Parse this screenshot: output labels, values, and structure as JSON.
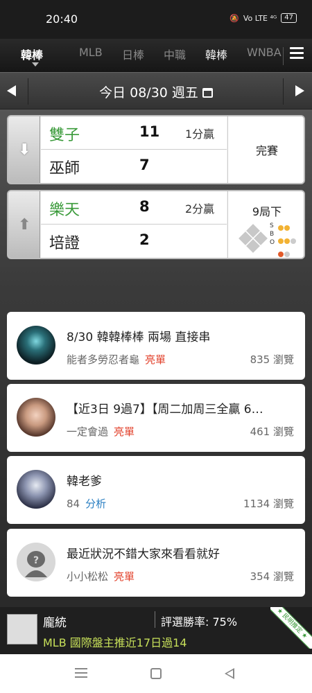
{
  "status_bar": {
    "time": "20:40",
    "network": "Vo LTE ⁴ᴳ",
    "battery": "47"
  },
  "tabs": {
    "active": "韓棒",
    "items": [
      "MLB",
      "日棒",
      "中職",
      "韓棒",
      "WNBA"
    ]
  },
  "datebar": {
    "date_text": "今日 08/30 週五"
  },
  "games": [
    {
      "home": {
        "name": "雙子",
        "score": "11",
        "note": "1分贏"
      },
      "away": {
        "name": "巫師",
        "score": "7",
        "note": ""
      },
      "status": "完賽"
    },
    {
      "home": {
        "name": "樂天",
        "score": "8",
        "note": "2分贏"
      },
      "away": {
        "name": "培證",
        "score": "2",
        "note": ""
      },
      "status": "9局下",
      "sbo_labels": [
        "S",
        "B",
        "O"
      ]
    }
  ],
  "posts": [
    {
      "title": "8/30 韓韓棒棒 兩場 直接串",
      "author": "能者多勞忍者龜",
      "tag": "亮單",
      "views": "835 瀏覽"
    },
    {
      "title": "【近3日 9過7】【周二加周三全贏 6…",
      "author": "一定會過",
      "tag": "亮單",
      "views": "461 瀏覽"
    },
    {
      "title": "韓老爹",
      "author": "84",
      "tag": "分析",
      "views": "1134 瀏覽"
    },
    {
      "title": "最近狀況不錯大家來看看就好",
      "author": "小小松松",
      "tag": "亮單",
      "views": "354 瀏覽"
    }
  ],
  "banner": {
    "name": "龐統",
    "rate": "評選勝率: 75%",
    "text": "MLB 國際盤主推近17日過14",
    "ribbon": "★ 民明推定 ★"
  },
  "colors": {
    "win_green": "#3a9a3a",
    "tag_red": "#e2412b",
    "tag_blue": "#2a7fc2",
    "banner_text": "#c7e05a"
  }
}
